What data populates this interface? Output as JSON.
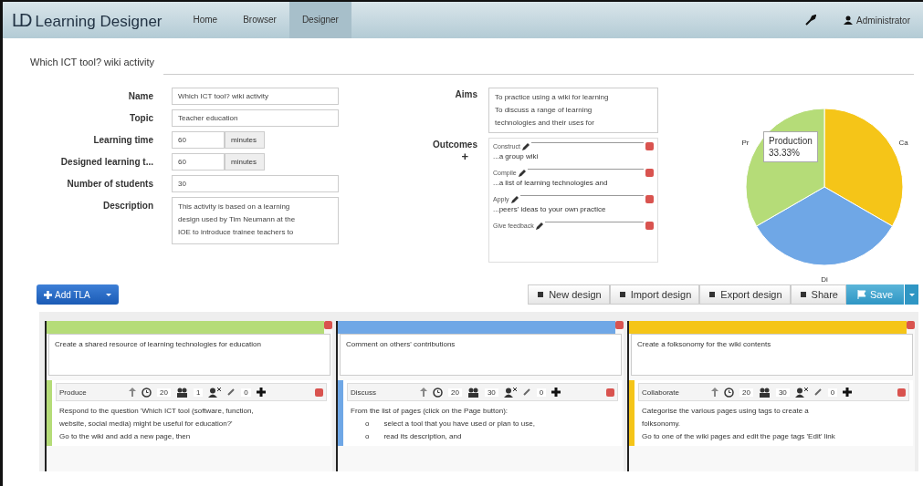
{
  "nav": {
    "logo": "LD",
    "brand": "Learning Designer",
    "items": [
      {
        "label": "Home",
        "selected": false
      },
      {
        "label": "Browser",
        "selected": false
      },
      {
        "label": "Designer",
        "selected": true
      }
    ],
    "user": "Administrator"
  },
  "design_tab": "Which ICT tool? wiki activity",
  "fields": [
    {
      "label": "Name",
      "value": "Which ICT tool? wiki activity"
    },
    {
      "label": "Topic",
      "value": "Teacher education"
    },
    {
      "label": "Learning time",
      "value": "60",
      "unit": "minutes"
    },
    {
      "label": "Designed learning t...",
      "value": "60",
      "unit": "minutes"
    },
    {
      "label": "Number of students",
      "value": "30"
    },
    {
      "label": "Description",
      "kind": "textarea",
      "lines": [
        "This activity is based on a learning",
        "design used by Tim Neumann at the",
        "IOE to introduce trainee teachers to"
      ]
    }
  ],
  "aims": {
    "label": "Aims",
    "lines": [
      "To practice using a wiki for learning",
      "To discuss a range of learning",
      "technologies and their uses for"
    ]
  },
  "outcomes": {
    "label": "Outcomes",
    "add": "+",
    "items": [
      {
        "verb": "Construct",
        "text": "...a group wiki"
      },
      {
        "verb": "Compile",
        "text": "...a list of learning technologies and"
      },
      {
        "verb": "Apply",
        "text": "...peers' ideas to your own practice"
      },
      {
        "verb": "Give feedback"
      }
    ]
  },
  "chart": {
    "tooltip": [
      "Production",
      "33.33%"
    ],
    "chart_data": {
      "type": "pie",
      "categories": [
        "Ca",
        "Di",
        "Pr"
      ],
      "series": [
        {
          "values": [
            33.33,
            33.33,
            33.33
          ]
        }
      ],
      "colors": [
        "#f5c518",
        "#6fa7e6",
        "#b5dc78"
      ]
    }
  },
  "toolbar": {
    "add": "Add TLA",
    "buttons": [
      "New design",
      "Import design",
      "Export design",
      "Share"
    ],
    "save": "Save"
  },
  "tlas": [
    {
      "color": "#b5dc78",
      "title": "Create a shared resource of learning technologies for education",
      "activity": {
        "type": "Produce",
        "duration": "20",
        "group": "1",
        "count": "0",
        "lines": [
          {
            "text": "Respond to the question 'Which ICT tool (software, function,"
          },
          {
            "text": "website, social media) might be useful for education?'"
          },
          {
            "text": "Go to the wiki and add a new page, then"
          }
        ]
      }
    },
    {
      "color": "#6fa7e6",
      "title": "Comment on others' contributions",
      "activity": {
        "type": "Discuss",
        "duration": "20",
        "group": "30",
        "count": "0",
        "lines": [
          {
            "text": "From the list of pages (click on the Page button):"
          },
          {
            "text": "select a tool that you have used or plan to use,",
            "bullet": "o"
          },
          {
            "text": "read its description, and",
            "bullet": "o"
          }
        ]
      }
    },
    {
      "color": "#f5c518",
      "title": "Create a folksonomy for the wiki contents",
      "activity": {
        "type": "Collaborate",
        "duration": "20",
        "group": "30",
        "count": "0",
        "lines": [
          {
            "text": "Categorise the various pages using tags to create a"
          },
          {
            "text": "folksonomy."
          },
          {
            "text": "Go to one of the wiki pages and edit the page tags 'Edit' link"
          }
        ]
      }
    }
  ]
}
